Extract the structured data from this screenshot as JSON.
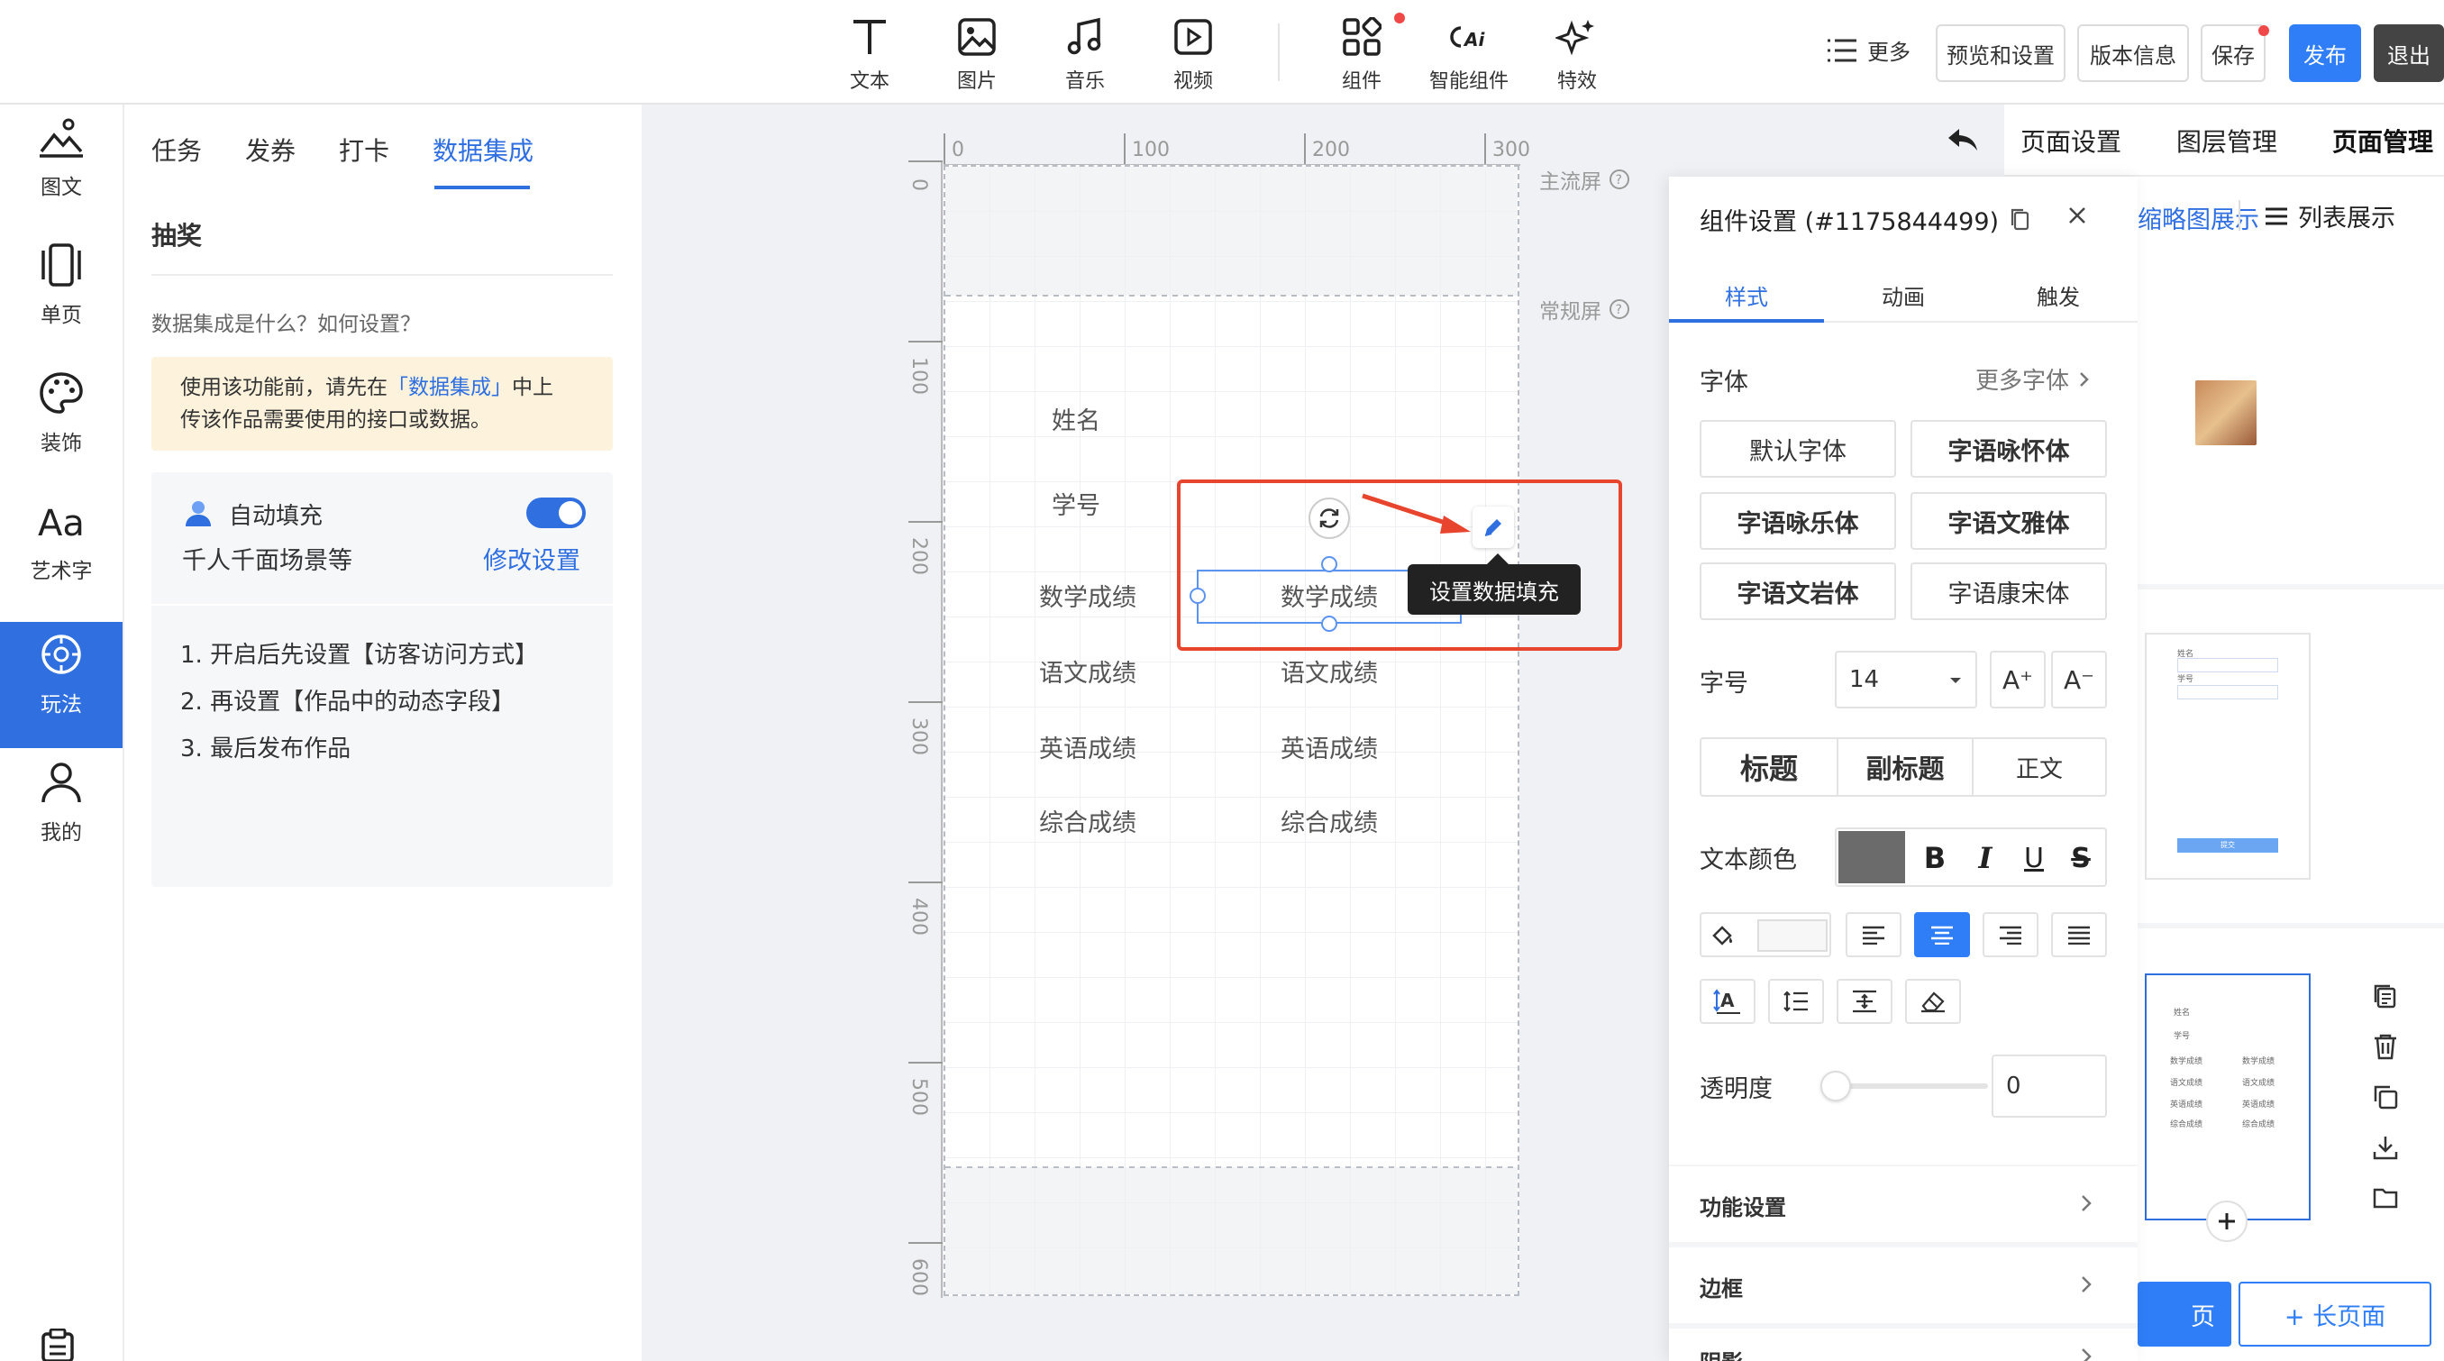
{
  "toolbar": {
    "tools": [
      {
        "label": "文本",
        "icon": "text-icon"
      },
      {
        "label": "图片",
        "icon": "image-icon"
      },
      {
        "label": "音乐",
        "icon": "music-icon"
      },
      {
        "label": "视频",
        "icon": "video-icon"
      },
      {
        "label": "组件",
        "icon": "component-icon"
      },
      {
        "label": "智能组件",
        "icon": "ai-component-icon"
      },
      {
        "label": "特效",
        "icon": "sparkle-icon"
      }
    ],
    "more_label": "更多",
    "preview_label": "预览和设置",
    "version_label": "版本信息",
    "save_label": "保存",
    "publish_label": "发布",
    "exit_label": "退出"
  },
  "leftnav": {
    "items": [
      {
        "label": "图文",
        "icon": "landscape-icon"
      },
      {
        "label": "单页",
        "icon": "single-page-icon"
      },
      {
        "label": "装饰",
        "icon": "palette-icon"
      },
      {
        "label": "艺术字",
        "icon": "art-text-icon"
      },
      {
        "label": "玩法",
        "icon": "play-icon"
      },
      {
        "label": "我的",
        "icon": "user-icon"
      }
    ],
    "active_index": 4
  },
  "panel": {
    "tabs": [
      "任务",
      "发券",
      "打卡",
      "数据集成"
    ],
    "active_tab": "数据集成",
    "section_title": "抽奖",
    "help_text": "数据集成是什么？如何设置？",
    "notice": {
      "line1_prefix": "使用该功能前，请先在",
      "line1_link": "「数据集成」",
      "line1_suffix": "中上",
      "line2": "传该作品需要使用的接口或数据。"
    },
    "autofill": {
      "title": "自动填充",
      "subtitle": "千人千面场景等",
      "modify_link": "修改设置",
      "enabled": true
    },
    "steps": [
      "1. 开启后先设置【访客访问方式】",
      "2. 再设置【作品中的动态字段】",
      "3. 最后发布作品"
    ]
  },
  "canvas": {
    "ruler_top": [
      "0",
      "100",
      "200",
      "300"
    ],
    "ruler_left": [
      "0",
      "100",
      "200",
      "300",
      "400",
      "500",
      "600"
    ],
    "screen_labels": {
      "main": "主流屏",
      "normal": "常规屏"
    },
    "fields": {
      "name": "姓名",
      "id": "学号",
      "math_label": "数学成绩",
      "math_value": "数学成绩",
      "chinese_label": "语文成绩",
      "chinese_value": "语文成绩",
      "english_label": "英语成绩",
      "english_value": "英语成绩",
      "total_label": "综合成绩",
      "total_value": "综合成绩"
    },
    "tooltip": "设置数据填充"
  },
  "settings": {
    "title": "组件设置 (#1175844499)",
    "tabs": [
      "样式",
      "动画",
      "触发"
    ],
    "active_tab": "样式",
    "font_label": "字体",
    "more_fonts": "更多字体",
    "fonts": [
      "默认字体",
      "字语咏怀体",
      "字语咏乐体",
      "字语文雅体",
      "字语文岩体",
      "字语康宋体"
    ],
    "size_label": "字号",
    "size_value": "14",
    "size_up": "A⁺",
    "size_down": "A⁻",
    "heading_buttons": [
      "标题",
      "副标题",
      "正文"
    ],
    "color_label": "文本颜色",
    "text_color": "#6b6b6b",
    "style_buttons": [
      "B",
      "I",
      "U",
      "S"
    ],
    "opacity_label": "透明度",
    "opacity_value": "0",
    "sections": [
      "功能设置",
      "边框",
      "阴影"
    ]
  },
  "rightpanel": {
    "tabs": [
      "页面设置",
      "图层管理",
      "页面管理"
    ],
    "active_tab": "页面管理",
    "view_grid": "缩略图展示",
    "view_list": "列表展示",
    "thumb_fields": [
      "姓名",
      "学号",
      "数学成绩",
      "数学成绩",
      "语文成绩",
      "语文成绩",
      "英语成绩",
      "英语成绩",
      "综合成绩",
      "综合成绩"
    ],
    "thumb2_fields": [
      "姓名",
      "学号"
    ],
    "submit_label": "提交",
    "add_page": "页",
    "add_long_page": "+ 长页面"
  },
  "colors": {
    "accent": "#2f6fe0",
    "highlight": "#e8452e",
    "notice_bg": "#fdf3dd"
  }
}
